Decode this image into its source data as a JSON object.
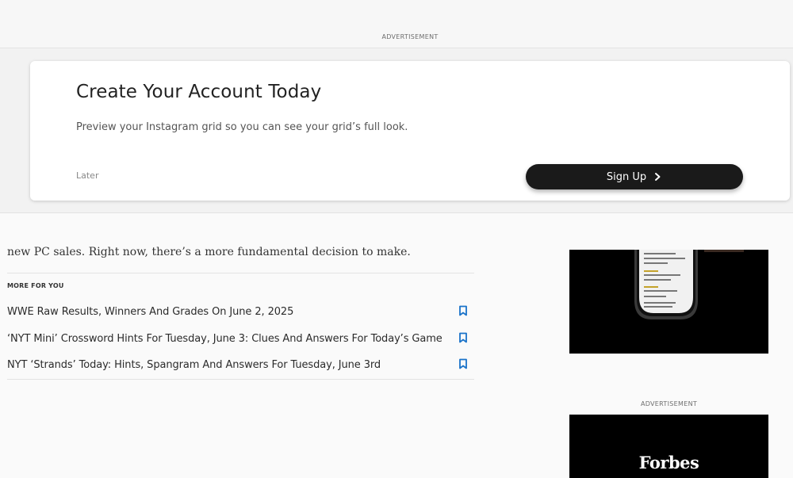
{
  "top_ad": {
    "label": "ADVERTISEMENT"
  },
  "signup": {
    "title": "Create Your Account Today",
    "subtitle": "Preview your Instagram grid so you can see your grid’s full look.",
    "later_label": "Later",
    "signup_label": "Sign Up",
    "signup_icon": "chevron-right-icon"
  },
  "article": {
    "snippet": "new PC sales. Right now, there’s a more fundamental decision to make."
  },
  "more_for_you": {
    "label": "MORE FOR YOU",
    "items": [
      {
        "headline": "WWE Raw Results, Winners And Grades On June 2, 2025",
        "icon": "bookmark-icon"
      },
      {
        "headline": "‘NYT Mini’ Crossword Hints For Tuesday, June 3: Clues And Answers For Today’s Game",
        "icon": "bookmark-icon"
      },
      {
        "headline": "NYT ‘Strands’ Today: Hints, Spangram And Answers For Tuesday, June 3rd",
        "icon": "bookmark-icon"
      }
    ]
  },
  "rail": {
    "ad_label": "ADVERTISEMENT",
    "brand": "Forbes"
  },
  "colors": {
    "button_bg": "#1a1a1a",
    "bookmark": "#1a73c9",
    "page_bg": "#fafafa"
  }
}
